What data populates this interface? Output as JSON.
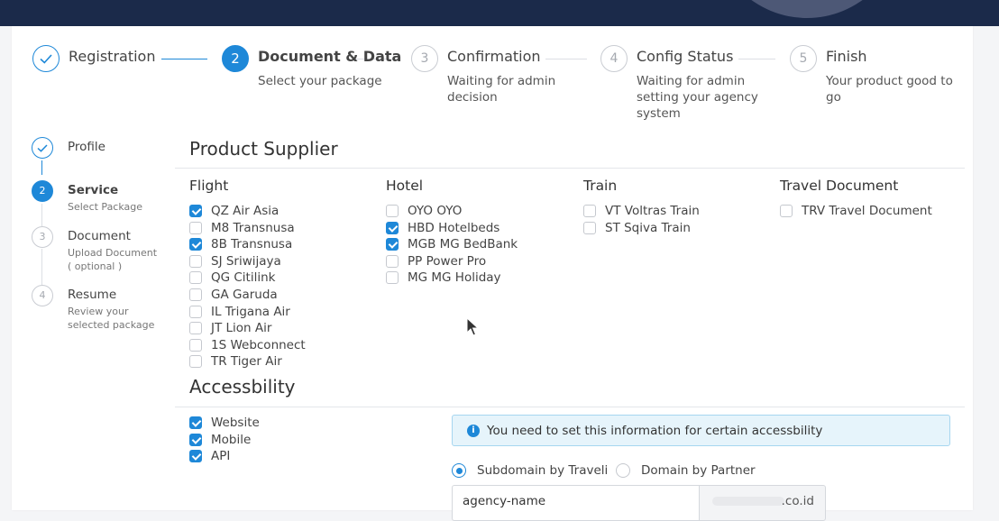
{
  "wizard": {
    "steps": [
      {
        "num": "",
        "title": "Registration",
        "subtitle": "",
        "state": "done"
      },
      {
        "num": "2",
        "title": "Document & Data",
        "subtitle": "Select your package",
        "state": "active"
      },
      {
        "num": "3",
        "title": "Confirmation",
        "subtitle": "Waiting for admin decision",
        "state": "pending"
      },
      {
        "num": "4",
        "title": "Config Status",
        "subtitle": "Waiting for admin setting your agency system",
        "state": "pending"
      },
      {
        "num": "5",
        "title": "Finish",
        "subtitle": "Your product good to go",
        "state": "pending"
      }
    ]
  },
  "sidebar": {
    "steps": [
      {
        "num": "",
        "title": "Profile",
        "subtitle": "",
        "state": "done"
      },
      {
        "num": "2",
        "title": "Service",
        "subtitle": "Select Package",
        "state": "active"
      },
      {
        "num": "3",
        "title": "Document",
        "subtitle": "Upload Document\n( optional )",
        "state": "pending"
      },
      {
        "num": "4",
        "title": "Resume",
        "subtitle": "Review your\nselected package",
        "state": "pending"
      }
    ]
  },
  "product_supplier": {
    "title": "Product Supplier",
    "columns": [
      {
        "heading": "Flight",
        "options": [
          {
            "label": "QZ Air Asia",
            "checked": true
          },
          {
            "label": "M8 Transnusa",
            "checked": false
          },
          {
            "label": "8B Transnusa",
            "checked": true
          },
          {
            "label": "SJ Sriwijaya",
            "checked": false
          },
          {
            "label": "QG Citilink",
            "checked": false
          },
          {
            "label": "GA Garuda",
            "checked": false
          },
          {
            "label": "IL Trigana Air",
            "checked": false
          },
          {
            "label": "JT Lion Air",
            "checked": false
          },
          {
            "label": "1S Webconnect",
            "checked": false
          },
          {
            "label": "TR Tiger Air",
            "checked": false
          }
        ]
      },
      {
        "heading": "Hotel",
        "options": [
          {
            "label": "OYO OYO",
            "checked": false
          },
          {
            "label": "HBD Hotelbeds",
            "checked": true
          },
          {
            "label": "MGB MG BedBank",
            "checked": true
          },
          {
            "label": "PP Power Pro",
            "checked": false
          },
          {
            "label": "MG MG Holiday",
            "checked": false
          }
        ]
      },
      {
        "heading": "Train",
        "options": [
          {
            "label": "VT Voltras Train",
            "checked": false
          },
          {
            "label": "ST Sqiva Train",
            "checked": false
          }
        ]
      },
      {
        "heading": "Travel Document",
        "options": [
          {
            "label": "TRV Travel Document",
            "checked": false
          }
        ]
      }
    ]
  },
  "accessibility": {
    "title": "Accessbility",
    "options": [
      {
        "label": "Website",
        "checked": true
      },
      {
        "label": "Mobile",
        "checked": true
      },
      {
        "label": "API",
        "checked": true
      }
    ],
    "info_text": "You need to set this information for certain accessbility",
    "domain_options": [
      {
        "label": "Subdomain by Traveli",
        "selected": true
      },
      {
        "label": "Domain by Partner",
        "selected": false
      }
    ],
    "domain_value": "agency-name",
    "domain_suffix": ".co.id"
  },
  "icons": {
    "check": "check-icon",
    "info": "info-icon",
    "cursor": "mouse-cursor-icon"
  },
  "colors": {
    "accent": "#1e88d8",
    "topbar": "#1b2a4a",
    "info_bg": "#e6f4fb"
  }
}
